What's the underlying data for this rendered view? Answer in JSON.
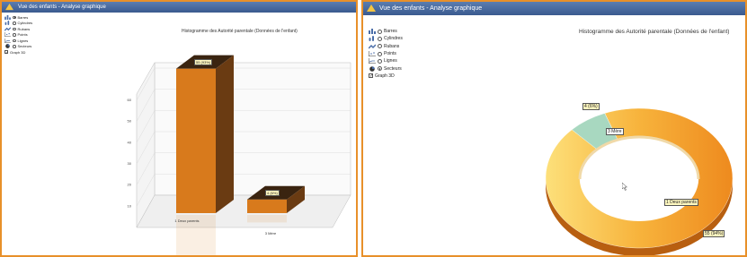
{
  "window_title": "Vue des enfants - Analyse graphique",
  "chart_options": [
    {
      "label": "Barres",
      "icon": "bar-chart-icon",
      "kind": "radio"
    },
    {
      "label": "Cylindres",
      "icon": "cylinder-chart-icon",
      "kind": "radio"
    },
    {
      "label": "Rubans",
      "icon": "ribbon-chart-icon",
      "kind": "radio"
    },
    {
      "label": "Points",
      "icon": "points-chart-icon",
      "kind": "radio"
    },
    {
      "label": "Lignes",
      "icon": "line-chart-icon",
      "kind": "radio"
    },
    {
      "label": "Secteurs",
      "icon": "pie-chart-icon",
      "kind": "radio"
    },
    {
      "label": "Graph 3D",
      "icon": "",
      "kind": "checkbox"
    }
  ],
  "left_panel": {
    "selected_option": "Barres",
    "graph_3d": true,
    "chart_data": {
      "type": "bar",
      "title": "Histogramme des Autorité parentale (Données de l'enfant)",
      "categories": [
        "1 Deux parents",
        "3 Mère"
      ],
      "values": [
        55,
        4
      ],
      "data_labels": [
        "55 (93%)",
        "4 (6%)"
      ],
      "y_ticks": [
        10,
        20,
        30,
        40,
        50,
        60
      ],
      "ylim": [
        0,
        60
      ],
      "three_d": true,
      "colors": {
        "front": "#d87a1c",
        "top": "#3a2410",
        "side": "#6a3b12"
      }
    }
  },
  "right_panel": {
    "selected_option": "Secteurs",
    "graph_3d": true,
    "chart_data": {
      "type": "pie",
      "title": "Histogramme des Autorité parentale (Données de l'enfant)",
      "slices": [
        {
          "label": "1 Deux parents",
          "value": 55,
          "value_label": "55 (94%)",
          "color": "#f0a030"
        },
        {
          "label": "3 Mère",
          "value": 4,
          "value_label": "4 (6%)",
          "color": "#a8d8c0"
        }
      ],
      "style": "doughnut",
      "three_d": true
    }
  }
}
